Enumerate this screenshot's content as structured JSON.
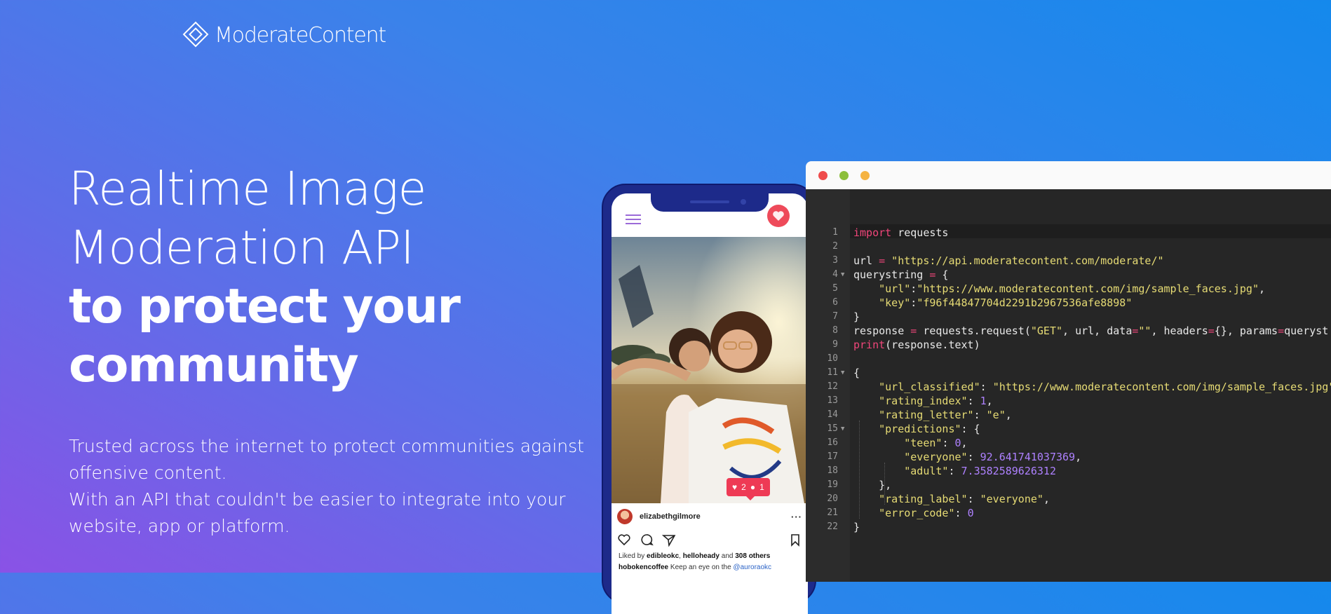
{
  "brand": {
    "name": "ModerateContent"
  },
  "hero": {
    "line1": "Realtime Image",
    "line2": "Moderation API",
    "line3": "to protect your",
    "line4": "community",
    "sub1": "Trusted across the internet to protect communities against",
    "sub2": "offensive content.",
    "sub3": "With an API that couldn't be easier to integrate into your",
    "sub4": "website, app or platform."
  },
  "phone": {
    "likes_badge": "2",
    "comments_badge": "1",
    "username": "elizabethgilmore",
    "more": "···",
    "liked_prefix": "Liked by ",
    "liked_user1": "edibleokc",
    "liked_sep": ", ",
    "liked_user2": "helloheady",
    "liked_and": " and ",
    "liked_others": "308 others",
    "caption_user": "hobokencoffee",
    "caption_text": " Keep an eye on the ",
    "caption_mention": "@auroraokc"
  },
  "code": {
    "line_numbers": [
      "1",
      "2",
      "3",
      "4",
      "5",
      "6",
      "7",
      "8",
      "9",
      "10",
      "11",
      "12",
      "13",
      "14",
      "15",
      "16",
      "17",
      "18",
      "19",
      "20",
      "21",
      "22"
    ],
    "l1_kw": "import",
    "l1_rest": " requests",
    "l3_var": "url ",
    "l3_op": "=",
    "l3_str": " \"https://api.moderatecontent.com/moderate/\"",
    "l4_var": "querystring ",
    "l4_op": "=",
    "l4_rest": " {",
    "l5_k": "\"url\"",
    "l5_c": ":",
    "l5_v": "\"https://www.moderatecontent.com/img/sample_faces.jpg\"",
    "l5_e": ",",
    "l6_k": "\"key\"",
    "l6_c": ":",
    "l6_v": "\"f96f44847704d2291b2967536afe8898\"",
    "l7": "}",
    "l8_a": "response ",
    "l8_op": "=",
    "l8_b": " requests.request(",
    "l8_s1": "\"GET\"",
    "l8_c": ", url, data",
    "l8_op2": "=",
    "l8_s2": "\"\"",
    "l8_d": ", headers",
    "l8_op3": "=",
    "l8_e": "{}, params",
    "l8_op4": "=",
    "l8_f": "queryst",
    "l9_fn": "print",
    "l9_rest": "(response.text)",
    "l11": "{",
    "l12_k": "\"url_classified\"",
    "l12_c": ": ",
    "l12_v": "\"https://www.moderatecontent.com/img/sample_faces.jpg\"",
    "l13_k": "\"rating_index\"",
    "l13_c": ": ",
    "l13_v": "1",
    "l13_e": ",",
    "l14_k": "\"rating_letter\"",
    "l14_c": ": ",
    "l14_v": "\"e\"",
    "l14_e": ",",
    "l15_k": "\"predictions\"",
    "l15_c": ": {",
    "l16_k": "\"teen\"",
    "l16_c": ": ",
    "l16_v": "0",
    "l16_e": ",",
    "l17_k": "\"everyone\"",
    "l17_c": ": ",
    "l17_v": "92.641741037369",
    "l17_e": ",",
    "l18_k": "\"adult\"",
    "l18_c": ": ",
    "l18_v": "7.3582589626312",
    "l19": "},",
    "l20_k": "\"rating_label\"",
    "l20_c": ": ",
    "l20_v": "\"everyone\"",
    "l20_e": ",",
    "l21_k": "\"error_code\"",
    "l21_c": ": ",
    "l21_v": "0",
    "l22": "}"
  },
  "colors": {
    "gradient_start": "#8a52e6",
    "gradient_end": "#1489ec",
    "editor_bg": "#262626",
    "keyword": "#f0467a",
    "string": "#e6db74",
    "number": "#ae81ff",
    "dot_red": "#ef4b4b",
    "dot_green": "#8cbf3c",
    "dot_yellow": "#f5b342"
  }
}
